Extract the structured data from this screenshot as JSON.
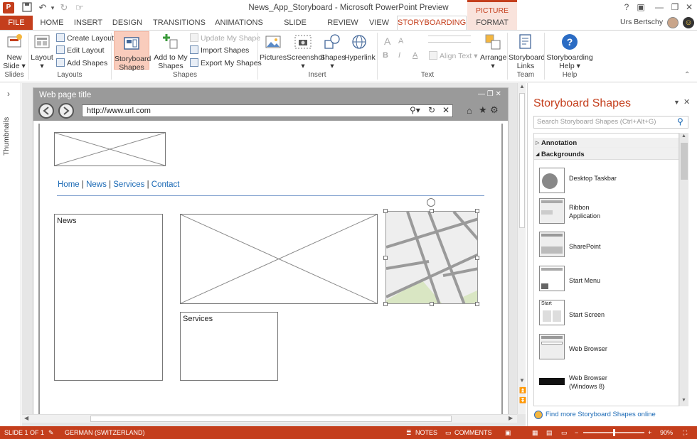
{
  "window": {
    "title": "News_App_Storyboard - Microsoft PowerPoint Preview",
    "context_tab_group": "PICTURE TOOLS",
    "user": "Urs Bertschy",
    "help_glyph": "?",
    "min_glyph": "—",
    "restore_glyph": "❐",
    "close_glyph": "✕",
    "ribbon_opts_glyph": "▣"
  },
  "qat": {
    "undo_glyph": "↶",
    "undo_dd": "▾",
    "redo_glyph": "↻",
    "touch_glyph": "☞"
  },
  "tabs": [
    "FILE",
    "HOME",
    "INSERT",
    "DESIGN",
    "TRANSITIONS",
    "ANIMATIONS",
    "SLIDE SHOW",
    "REVIEW",
    "VIEW",
    "STORYBOARDING",
    "FORMAT"
  ],
  "ribbon": {
    "new_slide": "New Slide",
    "new_slide_l1": "New",
    "new_slide_l2": "Slide ▾",
    "layout": "Layout",
    "create_layout": "Create Layout",
    "edit_layout": "Edit Layout",
    "add_shapes": "Add Shapes",
    "storyboard_shapes_l1": "Storyboard",
    "storyboard_shapes_l2": "Shapes",
    "add_to_my_l1": "Add to My",
    "add_to_my_l2": "Shapes",
    "update_my_shape": "Update My Shape",
    "import_shapes": "Import Shapes",
    "export_my_shapes": "Export My Shapes",
    "pictures": "Pictures",
    "screenshot": "Screenshot",
    "shapes": "Shapes",
    "hyperlink": "Hyperlink",
    "align_text": "Align Text ▾",
    "arrange": "Arrange",
    "storyboard_links_l1": "Storyboard",
    "storyboard_links_l2": "Links",
    "storyboarding_help_l1": "Storyboarding",
    "storyboarding_help_l2": "Help ▾",
    "font_a": "A",
    "font_b": "B",
    "font_i": "I",
    "groups": {
      "slides": "Slides",
      "layouts": "Layouts",
      "shapes": "Shapes",
      "insert": "Insert",
      "text": "Text",
      "team": "Team",
      "help": "Help"
    }
  },
  "thumbnails_label": "Thumbnails",
  "thumbs_chevron": "›",
  "slide": {
    "browser_title": "Web page title",
    "browser_ctl": "—  ❐  ✕",
    "url": "http://www.url.com",
    "nav": [
      "Home",
      "News",
      "Services",
      "Contact"
    ],
    "nav_sep": "|",
    "news_label": "News",
    "services_label": "Services"
  },
  "pane": {
    "title": "Storyboard Shapes",
    "search_placeholder": "Search Storyboard Shapes (Ctrl+Alt+G)",
    "categories": [
      "Annotation",
      "Backgrounds"
    ],
    "items": [
      {
        "label": "Desktop Taskbar"
      },
      {
        "label": "Ribbon Application"
      },
      {
        "label": "SharePoint"
      },
      {
        "label": "Start Menu"
      },
      {
        "label": "Start Screen"
      },
      {
        "label": "Web Browser"
      },
      {
        "label": "Web Browser (Windows 8)"
      }
    ],
    "start_thumb_text": "Start",
    "find_more": "Find more Storyboard Shapes online"
  },
  "status": {
    "slide": "SLIDE 1 OF 1",
    "language": "GERMAN (SWITZERLAND)",
    "notes": "NOTES",
    "comments": "COMMENTS",
    "zoom": "90%",
    "zoom_fill": 0.5
  },
  "colors": {
    "accent": "#c43e1c",
    "link": "#1a69b5",
    "browser_chrome": "#9a9a9a",
    "map_green": "#d9e6c3"
  }
}
